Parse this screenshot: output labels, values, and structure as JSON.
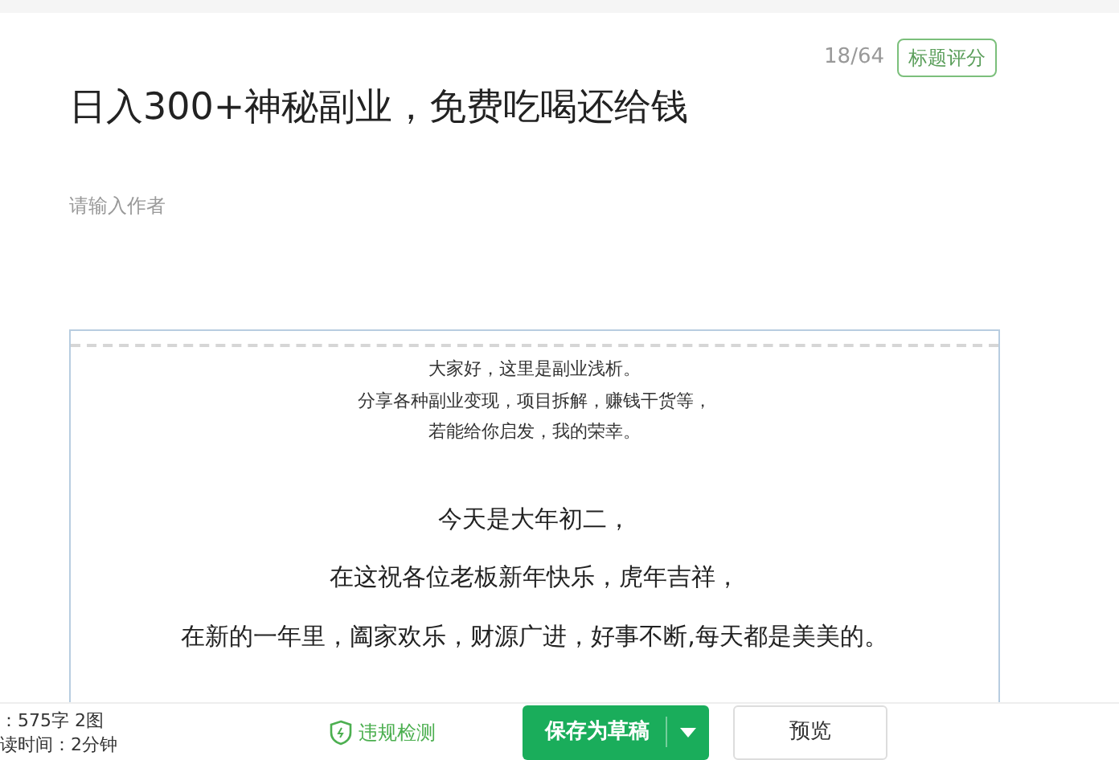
{
  "title_bar": {
    "count": "18/64",
    "score_button": "标题评分"
  },
  "title": "日入300+神秘副业，免费吃喝还给钱",
  "author_field": {
    "placeholder": "请输入作者"
  },
  "editor": {
    "intro": [
      "大家好，这里是副业浅析。",
      "分享各种副业变现，项目拆解，赚钱干货等，",
      "若能给你启发，我的荣幸。"
    ],
    "paragraphs": [
      "今天是大年初二，",
      "在这祝各位老板新年快乐，虎年吉祥，",
      "在新的一年里，阖家欢乐，财源广进，好事不断,每天都是美美的。"
    ]
  },
  "footer": {
    "stats": [
      "：575字 2图",
      "读时间：2分钟"
    ],
    "check_link": "违规检测",
    "save_button": "保存为草稿",
    "preview_button": "预览"
  }
}
